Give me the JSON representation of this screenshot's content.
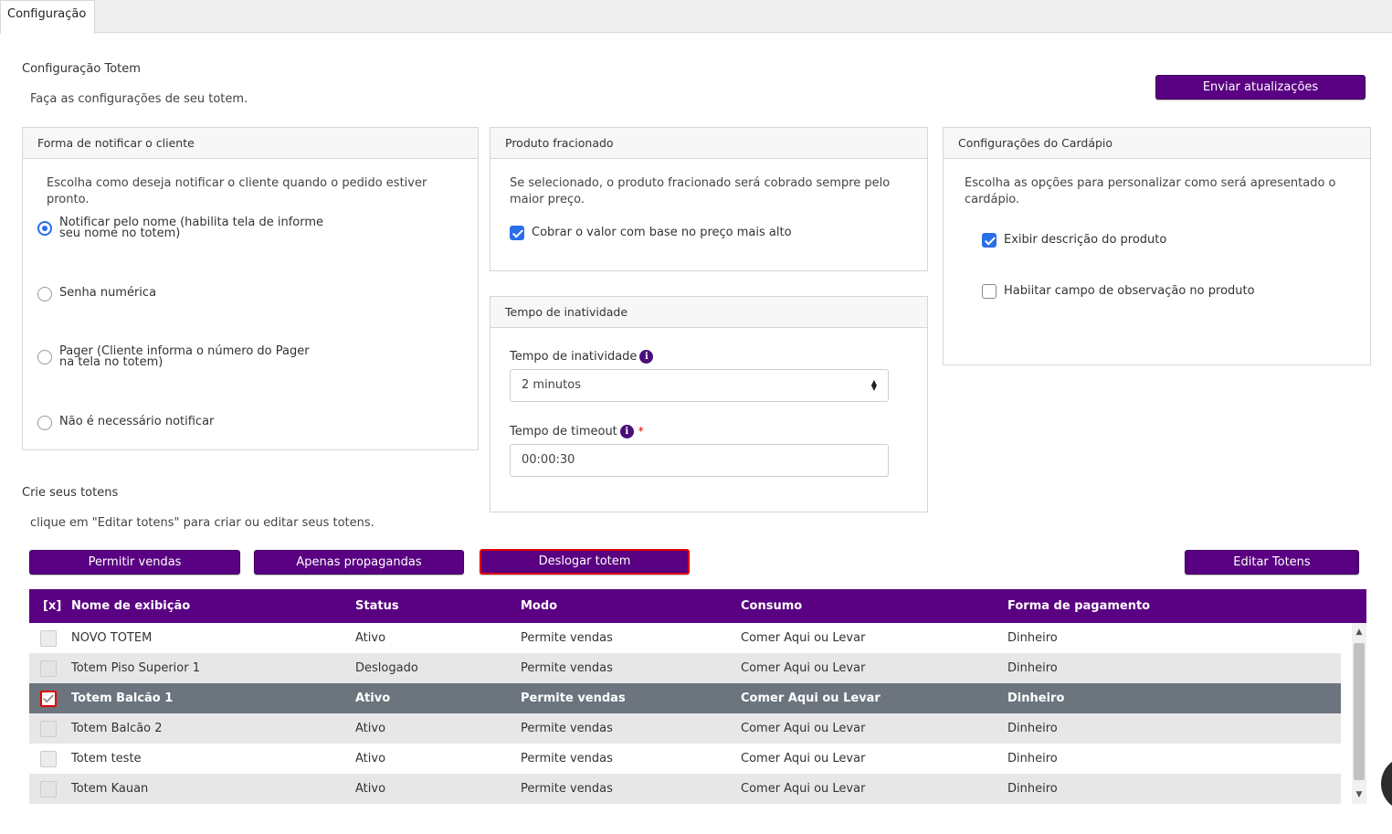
{
  "tab": {
    "label": "Configuração"
  },
  "header": {
    "title": "Configuração Totem",
    "subtitle": "Faça as configurações de seu totem.",
    "send_updates_label": "Enviar atualizações"
  },
  "notify_panel": {
    "title": "Forma de notificar o cliente",
    "description": "Escolha como deseja notificar o cliente quando o pedido estiver pronto.",
    "options": [
      {
        "label_line1": "Notificar pelo nome (habilita tela de informe",
        "label_line2": "seu nome no totem)",
        "selected": true
      },
      {
        "label_line1": "Senha numérica",
        "label_line2": "",
        "selected": false
      },
      {
        "label_line1": "Pager (Cliente informa o número do Pager",
        "label_line2": "na tela no totem)",
        "selected": false
      },
      {
        "label_line1": "Não é necessário notificar",
        "label_line2": "",
        "selected": false
      }
    ]
  },
  "fraction_panel": {
    "title": "Produto fracionado",
    "description": "Se selecionado, o produto fracionado será cobrado sempre pelo maior preço.",
    "checkbox_label": "Cobrar o valor com base no preço mais alto",
    "checked": true
  },
  "inactivity_panel": {
    "title": "Tempo de inatividade",
    "inactivity_label": "Tempo de inatividade",
    "inactivity_value": "2 minutos",
    "timeout_label": "Tempo de timeout",
    "timeout_required": "*",
    "timeout_value": "00:00:30",
    "info_icon": "i"
  },
  "menu_panel": {
    "title": "Configurações do Cardápio",
    "description": "Escolha as opções para personalizar como será apresentado o cardápio.",
    "options": [
      {
        "label": "Exibir descrição do produto",
        "checked": true
      },
      {
        "label": "Habiitar campo de observação no produto",
        "checked": false
      }
    ]
  },
  "totems_section": {
    "title": "Crie seus totens",
    "subtitle": "clique em \"Editar totens\" para criar ou editar seus totens.",
    "buttons": {
      "allow_sales": "Permitir vendas",
      "ads_only": "Apenas propagandas",
      "logout_totem": "Deslogar totem",
      "edit_totems": "Editar Totens"
    }
  },
  "table": {
    "select_all": "[x]",
    "columns": [
      "Nome de exibição",
      "Status",
      "Modo",
      "Consumo",
      "Forma de pagamento"
    ],
    "rows": [
      {
        "name": "NOVO TOTEM",
        "status": "Ativo",
        "mode": "Permite vendas",
        "consumption": "Comer Aqui ou Levar",
        "payment": "Dinheiro",
        "checked": false
      },
      {
        "name": "Totem Piso Superior 1",
        "status": "Deslogado",
        "mode": "Permite vendas",
        "consumption": "Comer Aqui ou Levar",
        "payment": "Dinheiro",
        "checked": false
      },
      {
        "name": "Totem Balcão 1",
        "status": "Ativo",
        "mode": "Permite vendas",
        "consumption": "Comer Aqui ou Levar",
        "payment": "Dinheiro",
        "checked": true
      },
      {
        "name": "Totem Balcão 2",
        "status": "Ativo",
        "mode": "Permite vendas",
        "consumption": "Comer Aqui ou Levar",
        "payment": "Dinheiro",
        "checked": false
      },
      {
        "name": "Totem teste",
        "status": "Ativo",
        "mode": "Permite vendas",
        "consumption": "Comer Aqui ou Levar",
        "payment": "Dinheiro",
        "checked": false
      },
      {
        "name": "Totem Kauan",
        "status": "Ativo",
        "mode": "Permite vendas",
        "consumption": "Comer Aqui ou Levar",
        "payment": "Dinheiro",
        "checked": false
      }
    ]
  },
  "colors": {
    "accent": "#5a0082",
    "selected_row": "#6c757d",
    "checkbox": "#2a6ee8",
    "highlight_border": "#e00000"
  }
}
